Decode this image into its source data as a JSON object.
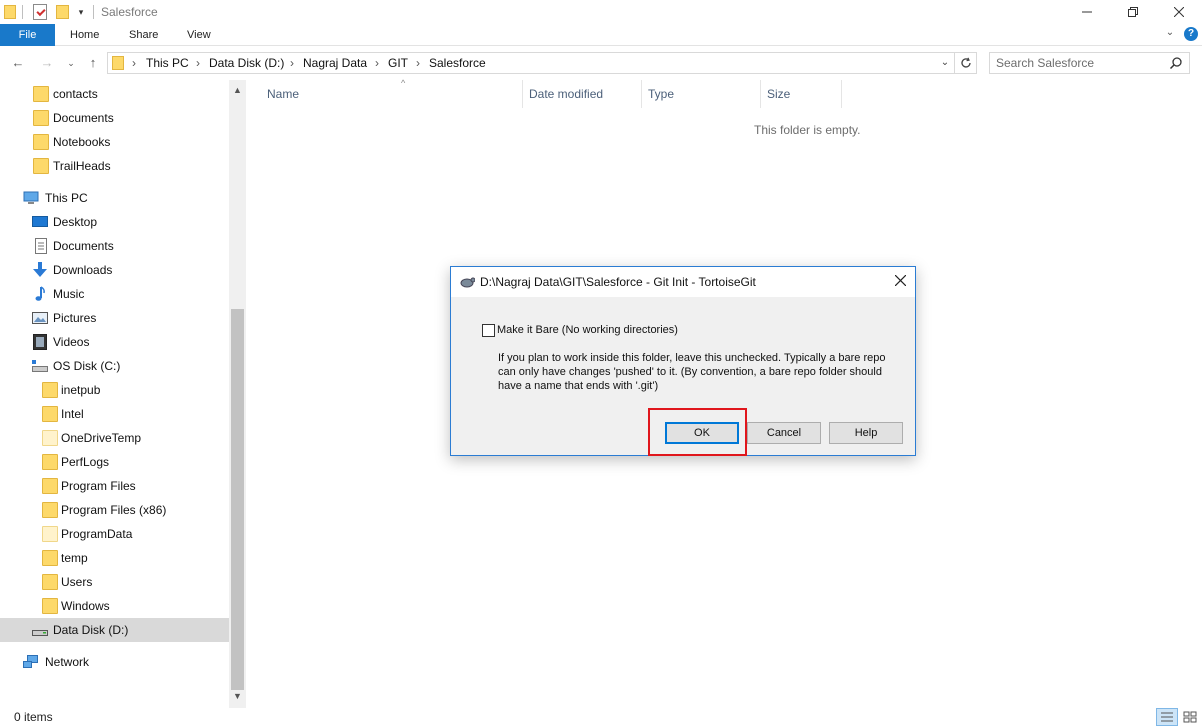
{
  "window": {
    "title": "Salesforce",
    "minimize_icon": "minimize-icon",
    "restore_icon": "restore-icon",
    "close_icon": "close-icon"
  },
  "ribbon": {
    "tabs": [
      {
        "label": "File"
      },
      {
        "label": "Home"
      },
      {
        "label": "Share"
      },
      {
        "label": "View"
      }
    ],
    "help": "?"
  },
  "address": {
    "breadcrumbs": [
      "This PC",
      "Data Disk (D:)",
      "Nagraj Data",
      "GIT",
      "Salesforce"
    ]
  },
  "search": {
    "placeholder": "Search Salesforce"
  },
  "nav_pane": {
    "items": [
      {
        "label": "contacts",
        "icon": "folder-icon"
      },
      {
        "label": "Documents",
        "icon": "folder-icon"
      },
      {
        "label": "Notebooks",
        "icon": "folder-icon"
      },
      {
        "label": "TrailHeads",
        "icon": "folder-icon"
      },
      {
        "label": "This PC",
        "icon": "computer-icon"
      },
      {
        "label": "Desktop",
        "icon": "desktop-icon"
      },
      {
        "label": "Documents",
        "icon": "documents-icon"
      },
      {
        "label": "Downloads",
        "icon": "download-icon"
      },
      {
        "label": "Music",
        "icon": "music-icon"
      },
      {
        "label": "Pictures",
        "icon": "pictures-icon"
      },
      {
        "label": "Videos",
        "icon": "videos-icon"
      },
      {
        "label": "OS Disk (C:)",
        "icon": "drive-icon"
      },
      {
        "label": "inetpub",
        "icon": "folder-icon"
      },
      {
        "label": "Intel",
        "icon": "folder-icon"
      },
      {
        "label": "OneDriveTemp",
        "icon": "folder-icon"
      },
      {
        "label": "PerfLogs",
        "icon": "folder-icon"
      },
      {
        "label": "Program Files",
        "icon": "folder-icon"
      },
      {
        "label": "Program Files (x86)",
        "icon": "folder-icon"
      },
      {
        "label": "ProgramData",
        "icon": "folder-icon"
      },
      {
        "label": "temp",
        "icon": "folder-icon"
      },
      {
        "label": "Users",
        "icon": "folder-icon"
      },
      {
        "label": "Windows",
        "icon": "folder-icon"
      },
      {
        "label": "Data Disk (D:)",
        "icon": "drive-icon"
      },
      {
        "label": "Network",
        "icon": "network-icon"
      }
    ],
    "selected": "Data Disk (D:)"
  },
  "file_list": {
    "columns": [
      "Name",
      "Date modified",
      "Type",
      "Size"
    ],
    "empty_message": "This folder is empty."
  },
  "status": {
    "item_count": "0 items"
  },
  "dialog": {
    "title": "D:\\Nagraj Data\\GIT\\Salesforce - Git Init - TortoiseGit",
    "checkbox_label": "Make it Bare (No working directories)",
    "checkbox_checked": false,
    "description": "If you plan to work inside this folder, leave this unchecked. Typically a bare repo can only have changes 'pushed' to it. (By convention, a bare repo folder should have a name that ends with '.git')",
    "buttons": {
      "ok": "OK",
      "cancel": "Cancel",
      "help": "Help"
    },
    "highlight_color": "#e0161c"
  },
  "colors": {
    "accent": "#1979ca",
    "selection": "#d9d9d9",
    "folder": "#fdd96a"
  }
}
